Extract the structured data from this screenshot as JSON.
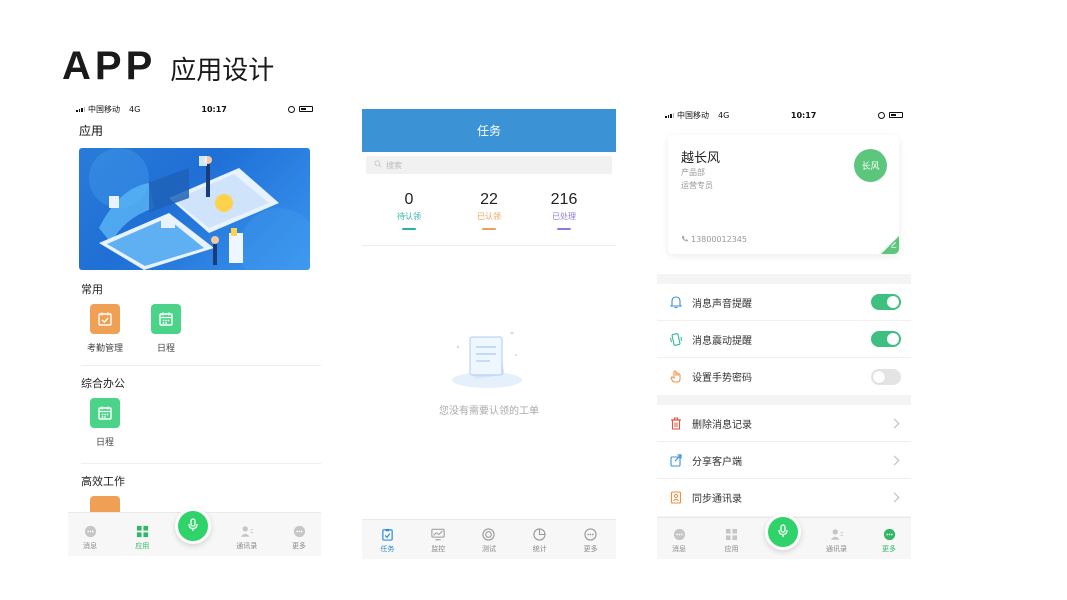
{
  "slide": {
    "title_en": "APP",
    "title_cn": "应用设计"
  },
  "status_bar": {
    "carrier": "中国移动",
    "network": "4G",
    "time": "10:17"
  },
  "phone1": {
    "page_title": "应用",
    "sections": [
      {
        "title": "常用",
        "apps": [
          {
            "label": "考勤管理",
            "icon": "attendance-icon",
            "color": "#f0a054"
          },
          {
            "label": "日程",
            "icon": "calendar-icon",
            "color": "#4cd38a"
          }
        ]
      },
      {
        "title": "综合办公",
        "apps": [
          {
            "label": "日程",
            "icon": "calendar-icon",
            "color": "#4cd38a"
          }
        ]
      },
      {
        "title": "高效工作",
        "apps": []
      }
    ],
    "tabs": [
      {
        "label": "消息"
      },
      {
        "label": "应用"
      },
      {
        "label": "通讯录"
      },
      {
        "label": "更多"
      }
    ]
  },
  "phone2": {
    "header_title": "任务",
    "search_placeholder": "搜索",
    "stats": [
      {
        "value": "0",
        "label": "待认领",
        "color": "#2ab0a8"
      },
      {
        "value": "22",
        "label": "已认领",
        "color": "#f0a054"
      },
      {
        "value": "216",
        "label": "已处理",
        "color": "#8a7de0"
      }
    ],
    "empty_text": "您没有需要认领的工单",
    "tabs": [
      {
        "label": "任务"
      },
      {
        "label": "监控"
      },
      {
        "label": "测试"
      },
      {
        "label": "统计"
      },
      {
        "label": "更多"
      }
    ]
  },
  "phone3": {
    "profile": {
      "name": "越长风",
      "department": "产品部",
      "role": "运营专员",
      "phone": "13800012345",
      "avatar_text": "长风"
    },
    "toggles": [
      {
        "label": "消息声音提醒",
        "on": true
      },
      {
        "label": "消息震动提醒",
        "on": true
      },
      {
        "label": "设置手势密码",
        "on": false
      }
    ],
    "actions": [
      {
        "label": "删除消息记录"
      },
      {
        "label": "分享客户端"
      },
      {
        "label": "同步通讯录"
      }
    ],
    "tabs": [
      {
        "label": "消息"
      },
      {
        "label": "应用"
      },
      {
        "label": "通讯录"
      },
      {
        "label": "更多"
      }
    ]
  },
  "colors": {
    "accent_green": "#2fd36a",
    "header_blue": "#3b93d5",
    "toggle_on": "#3dc080"
  }
}
